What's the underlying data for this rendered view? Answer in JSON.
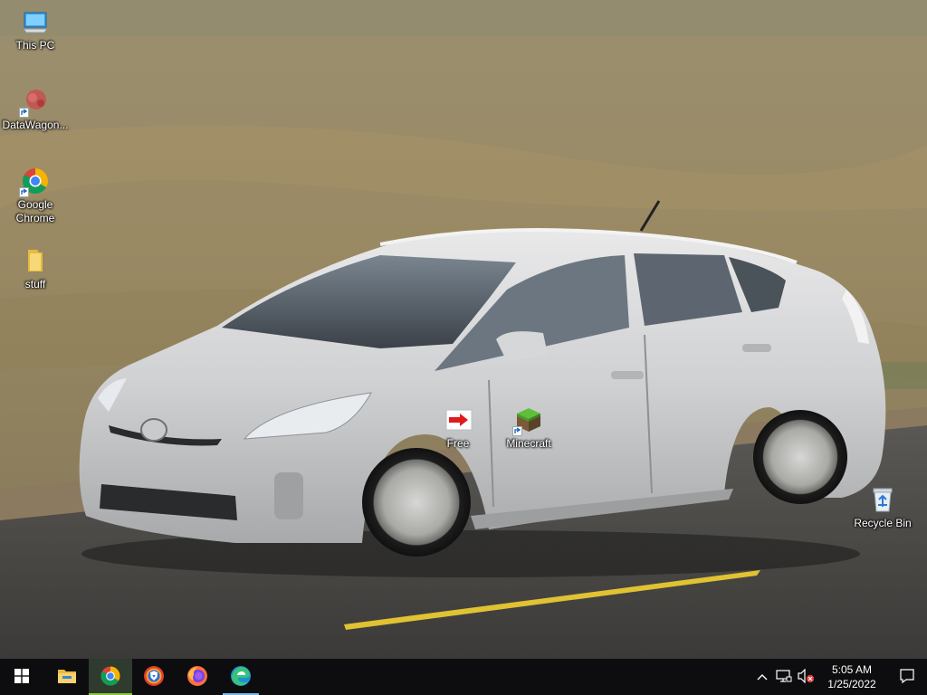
{
  "desktop": {
    "icons": [
      {
        "label": "This PC",
        "icon": "computer-icon"
      },
      {
        "label": "DataWagon...",
        "icon": "datawagon-icon"
      },
      {
        "label": "Google Chrome",
        "icon": "chrome-icon"
      },
      {
        "label": "stuff",
        "icon": "folder-icon"
      },
      {
        "label": "Free",
        "icon": "red-arrow-icon"
      },
      {
        "label": "Minecraft",
        "icon": "minecraft-icon"
      },
      {
        "label": "Recycle Bin",
        "icon": "recycle-bin-icon"
      }
    ]
  },
  "taskbar": {
    "start": {
      "icon": "windows-start-icon"
    },
    "apps": [
      {
        "icon": "file-explorer-icon"
      },
      {
        "icon": "chrome-icon"
      },
      {
        "icon": "brave-browser-icon"
      },
      {
        "icon": "firefox-icon"
      },
      {
        "icon": "edge-icon"
      }
    ],
    "tray": {
      "icons": [
        "chevron-up-icon",
        "network-icon",
        "volume-muted-icon"
      ],
      "time": "5:05 AM",
      "date": "1/25/2022",
      "notification_icon": "action-center-icon"
    }
  },
  "colors": {
    "taskbar": "#0d0d0f",
    "accent_active": "#8dc63f",
    "accent_running": "#76b9ed"
  }
}
